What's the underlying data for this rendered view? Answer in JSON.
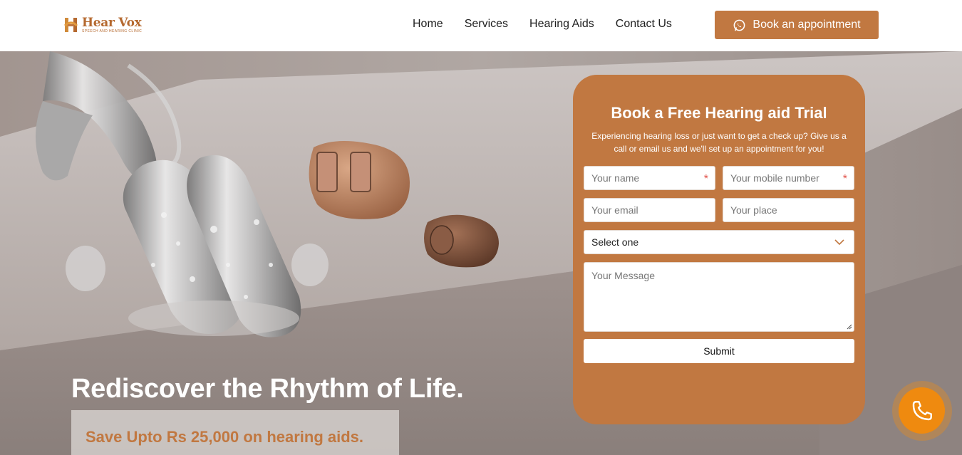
{
  "header": {
    "logo": {
      "name": "Hear Vox",
      "tagline": "SPEECH AND HEARING CLINIC",
      "mark_icon": "hearvox-h-logo-icon"
    },
    "nav": [
      {
        "label": "Home"
      },
      {
        "label": "Services"
      },
      {
        "label": "Hearing Aids"
      },
      {
        "label": "Contact Us"
      }
    ],
    "cta": {
      "label": "Book an appointment",
      "icon": "whatsapp-icon"
    }
  },
  "hero": {
    "headline": "Rediscover the Rhythm of Life.",
    "promo": "Save Upto Rs 25,000 on hearing aids."
  },
  "form": {
    "title": "Book a Free Hearing aid Trial",
    "description": "Experiencing hearing loss or just want to get a check up? Give us a call or email us and we'll set up an appointment for you!",
    "name_placeholder": "Your name",
    "phone_placeholder": "Your mobile number",
    "required_mark": "*",
    "email_placeholder": "Your email",
    "place_placeholder": "Your place",
    "select_value": "Select one",
    "message_placeholder": "Your Message",
    "submit_label": "Submit"
  },
  "floating": {
    "call_icon": "phone-icon"
  },
  "colors": {
    "accent": "#c17841",
    "call_button": "#ef8a0f",
    "required": "#e2554d",
    "header_bg": "#ffffff"
  }
}
